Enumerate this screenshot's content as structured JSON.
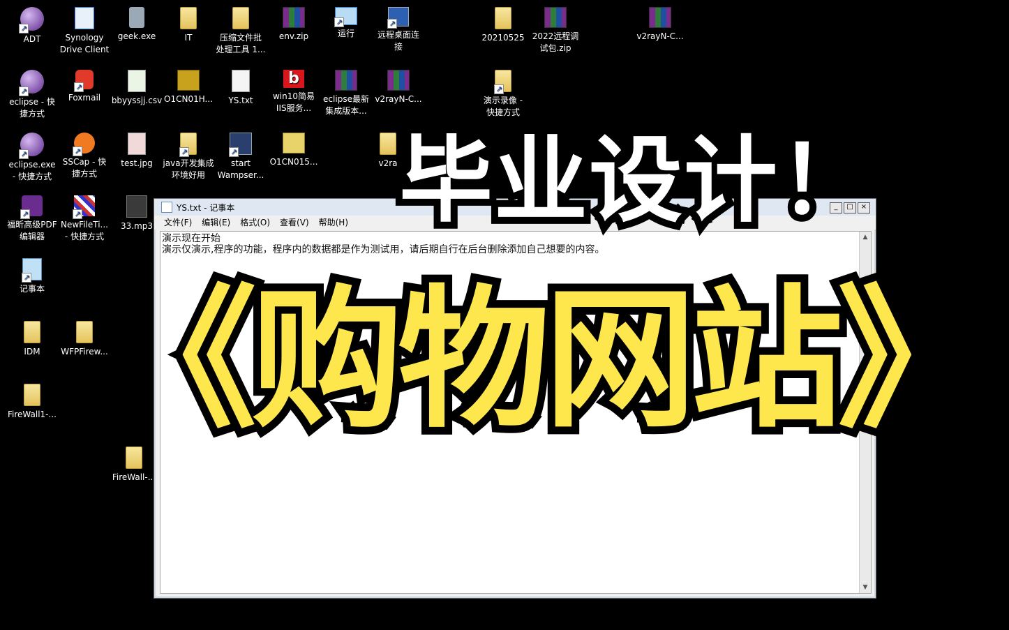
{
  "desktop_icons": [
    {
      "label": "ADT",
      "icon": "eclipse-orb-icon"
    },
    {
      "label": "Synology\nDrive Client",
      "icon": "synology-icon"
    },
    {
      "label": "geek.exe",
      "icon": "recycle-bin-icon"
    },
    {
      "label": "IT",
      "icon": "folder-icon"
    },
    {
      "label": "压缩文件批\n处理工具 1...",
      "icon": "folder-icon"
    },
    {
      "label": "env.zip",
      "icon": "rar-icon"
    },
    {
      "label": "运行",
      "icon": "run-icon"
    },
    {
      "label": "远程桌面连\n接",
      "icon": "remote-desktop-icon"
    },
    {
      "label": "20210525",
      "icon": "folder-icon"
    },
    {
      "label": "2022远程调\n试包.zip",
      "icon": "rar-icon"
    },
    {
      "label": "v2rayN-C...",
      "icon": "rar-icon"
    },
    {
      "label": "eclipse - 快\n捷方式",
      "icon": "eclipse-orb-icon"
    },
    {
      "label": "Foxmail",
      "icon": "foxmail-icon"
    },
    {
      "label": "bbyyssjj.csv",
      "icon": "csv-icon"
    },
    {
      "label": "O1CN01H...",
      "icon": "image-icon"
    },
    {
      "label": "YS.txt",
      "icon": "text-file-icon"
    },
    {
      "label": "win10简易\nIIS服务...",
      "icon": "b-icon"
    },
    {
      "label": "eclipse最新\n集成版本...",
      "icon": "rar-icon"
    },
    {
      "label": "v2rayN-C...",
      "icon": "rar-icon"
    },
    {
      "label": "演示录像 -\n快捷方式",
      "icon": "folder-icon"
    },
    {
      "label": "eclipse.exe\n- 快捷方式",
      "icon": "eclipse-orb-icon"
    },
    {
      "label": "SSCap - 快\n捷方式",
      "icon": "sscap-icon"
    },
    {
      "label": "test.jpg",
      "icon": "jpg-icon"
    },
    {
      "label": "java开发集成\n环境好用",
      "icon": "folder-icon"
    },
    {
      "label": "start\nWampser...",
      "icon": "wamp-icon"
    },
    {
      "label": "O1CN015...",
      "icon": "image-icon"
    },
    {
      "label": "v2ra",
      "icon": "folder-icon"
    },
    {
      "label": "福昕高级PDF\n编辑器",
      "icon": "pdf-icon"
    },
    {
      "label": "NewFileTi...\n- 快捷方式",
      "icon": "newfiletime-icon"
    },
    {
      "label": "33.mp3",
      "icon": "mp3-icon"
    },
    {
      "label": "记事本",
      "icon": "notepad-icon"
    },
    {
      "label": "IDM",
      "icon": "folder-icon"
    },
    {
      "label": "WFPFirew...",
      "icon": "folder-icon"
    },
    {
      "label": "FireWall1-...",
      "icon": "folder-icon"
    },
    {
      "label": "FireWall-...",
      "icon": "folder-icon"
    }
  ],
  "notepad": {
    "title": "YS.txt - 记事本",
    "menu": [
      "文件(F)",
      "编辑(E)",
      "格式(O)",
      "查看(V)",
      "帮助(H)"
    ],
    "lines": [
      "演示现在开始",
      "演示仅演示,程序的功能，程序内的数据都是作为测试用，请后期自行在后台删除添加自己想要的内容。"
    ]
  },
  "overlay": {
    "line1": "毕业设计！",
    "line2": "《购物网站》"
  },
  "colors": {
    "overlay_yellow": "#fde74c",
    "overlay_white": "#ffffff"
  }
}
